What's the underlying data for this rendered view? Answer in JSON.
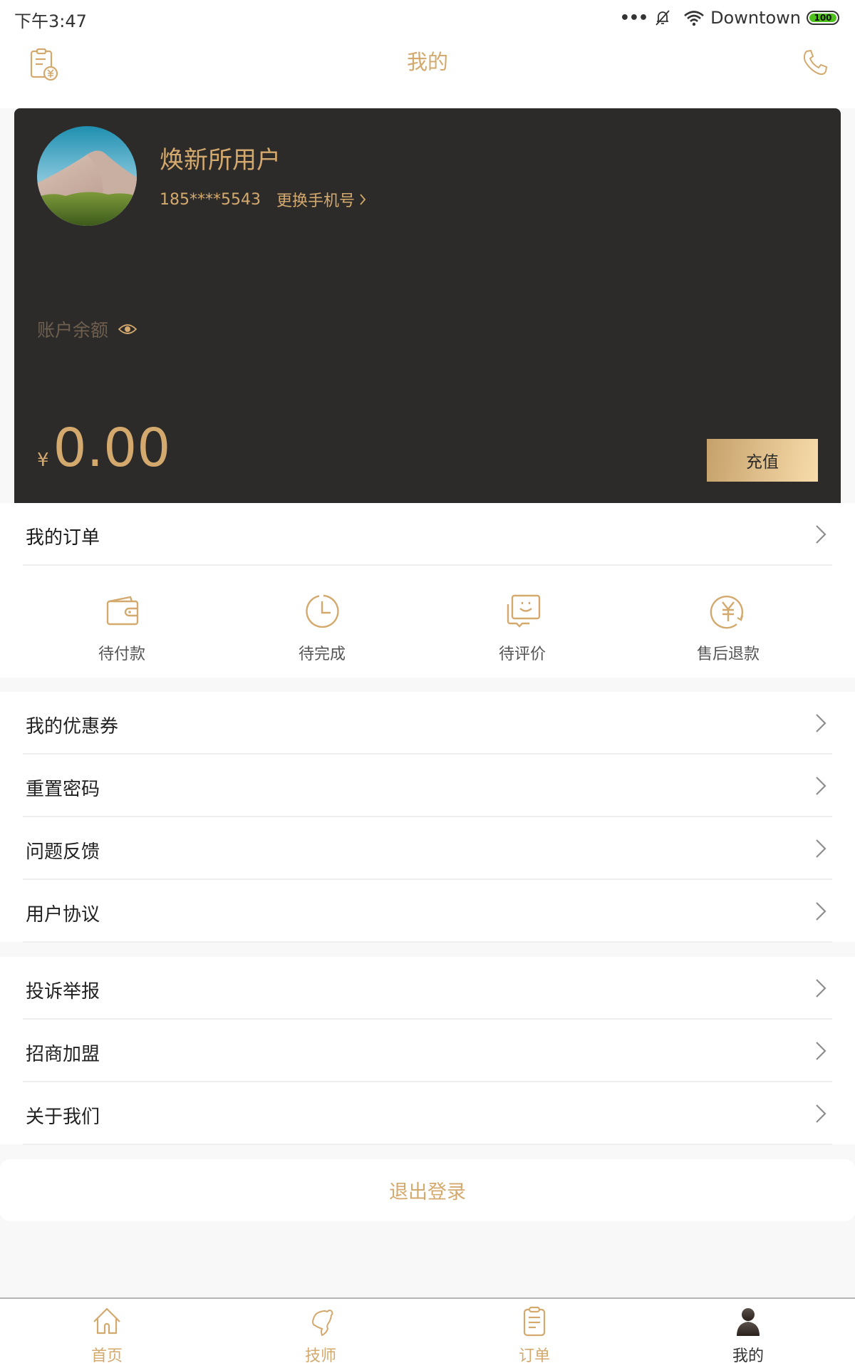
{
  "status_bar": {
    "time": "下午3:47",
    "dots": "•••",
    "network_name": "Downtown",
    "battery": "100"
  },
  "header": {
    "title": "我的",
    "left_icon": "bill-clipboard-yuan-icon",
    "right_icon": "phone-icon"
  },
  "profile": {
    "username": "焕新所用户",
    "phone": "185****5543",
    "change_phone_label": "更换手机号",
    "balance_label": "账户余额",
    "currency_symbol": "¥",
    "balance": "0.00",
    "recharge_label": "充值"
  },
  "orders": {
    "title": "我的订单",
    "items": [
      {
        "label": "待付款",
        "icon": "wallet-icon"
      },
      {
        "label": "待完成",
        "icon": "clock-icon"
      },
      {
        "label": "待评价",
        "icon": "chat-smile-icon"
      },
      {
        "label": "售后退款",
        "icon": "yuan-refund-icon"
      }
    ]
  },
  "menu_group1": [
    {
      "label": "我的优惠券"
    },
    {
      "label": "重置密码"
    },
    {
      "label": "问题反馈"
    },
    {
      "label": "用户协议"
    }
  ],
  "menu_group2": [
    {
      "label": "投诉举报"
    },
    {
      "label": "招商加盟"
    },
    {
      "label": "关于我们"
    }
  ],
  "logout_label": "退出登录",
  "tabbar": {
    "active": 3,
    "tabs": [
      {
        "label": "首页",
        "icon": "home-icon"
      },
      {
        "label": "技师",
        "icon": "technician-head-icon"
      },
      {
        "label": "订单",
        "icon": "order-clipboard-icon"
      },
      {
        "label": "我的",
        "icon": "person-icon"
      }
    ]
  },
  "colors": {
    "accent_gold": "#d4a96e",
    "card_dark": "#2d2b2a",
    "battery_green": "#4cc21a"
  }
}
